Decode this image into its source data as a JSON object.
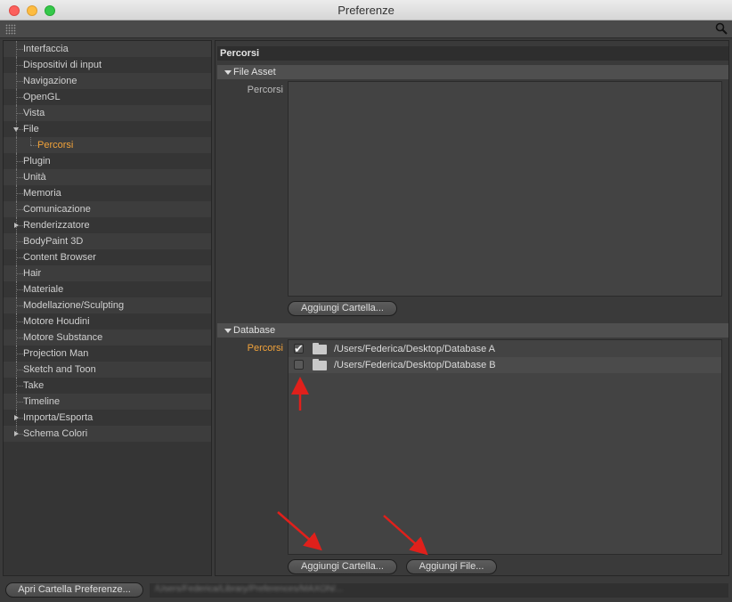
{
  "window": {
    "title": "Preferenze"
  },
  "sidebar": {
    "items": [
      {
        "label": "Interfaccia",
        "level": 0,
        "arrow": "none",
        "active": false
      },
      {
        "label": "Dispositivi di input",
        "level": 0,
        "arrow": "none",
        "active": false
      },
      {
        "label": "Navigazione",
        "level": 0,
        "arrow": "none",
        "active": false
      },
      {
        "label": "OpenGL",
        "level": 0,
        "arrow": "none",
        "active": false
      },
      {
        "label": "Vista",
        "level": 0,
        "arrow": "none",
        "active": false
      },
      {
        "label": "File",
        "level": 0,
        "arrow": "down",
        "active": false
      },
      {
        "label": "Percorsi",
        "level": 1,
        "arrow": "none",
        "active": true
      },
      {
        "label": "Plugin",
        "level": 0,
        "arrow": "none",
        "active": false
      },
      {
        "label": "Unità",
        "level": 0,
        "arrow": "none",
        "active": false
      },
      {
        "label": "Memoria",
        "level": 0,
        "arrow": "none",
        "active": false
      },
      {
        "label": "Comunicazione",
        "level": 0,
        "arrow": "none",
        "active": false
      },
      {
        "label": "Renderizzatore",
        "level": 0,
        "arrow": "right",
        "active": false
      },
      {
        "label": "BodyPaint 3D",
        "level": 0,
        "arrow": "none",
        "active": false
      },
      {
        "label": "Content Browser",
        "level": 0,
        "arrow": "none",
        "active": false
      },
      {
        "label": "Hair",
        "level": 0,
        "arrow": "none",
        "active": false
      },
      {
        "label": "Materiale",
        "level": 0,
        "arrow": "none",
        "active": false
      },
      {
        "label": "Modellazione/Sculpting",
        "level": 0,
        "arrow": "none",
        "active": false
      },
      {
        "label": "Motore Houdini",
        "level": 0,
        "arrow": "none",
        "active": false
      },
      {
        "label": "Motore Substance",
        "level": 0,
        "arrow": "none",
        "active": false
      },
      {
        "label": "Projection Man",
        "level": 0,
        "arrow": "none",
        "active": false
      },
      {
        "label": "Sketch and Toon",
        "level": 0,
        "arrow": "none",
        "active": false
      },
      {
        "label": "Take",
        "level": 0,
        "arrow": "none",
        "active": false
      },
      {
        "label": "Timeline",
        "level": 0,
        "arrow": "none",
        "active": false
      },
      {
        "label": "Importa/Esporta",
        "level": 0,
        "arrow": "right",
        "active": false
      },
      {
        "label": "Schema Colori",
        "level": 0,
        "arrow": "right",
        "active": false
      }
    ]
  },
  "main": {
    "title": "Percorsi",
    "file_asset": {
      "header": "File Asset",
      "field_label": "Percorsi",
      "add_folder_button": "Aggiungi Cartella..."
    },
    "database": {
      "header": "Database",
      "field_label": "Percorsi",
      "paths": [
        {
          "path": "/Users/Federica/Desktop/Database A",
          "checked": true
        },
        {
          "path": "/Users/Federica/Desktop/Database B",
          "checked": false
        }
      ],
      "add_folder_button": "Aggiungi Cartella...",
      "add_file_button": "Aggiungi File..."
    }
  },
  "footer": {
    "open_folder_button": "Apri Cartella Preferenze...",
    "path_blurred": "/Users/Federica/Library/Preferences/MAXON/..."
  },
  "colors": {
    "accent": "#f2a33a",
    "annotation_arrow": "#e0201b"
  },
  "icons": [
    "search-icon",
    "grip-icon",
    "folder-icon",
    "checkmark-icon",
    "triangle-down-icon",
    "triangle-right-icon"
  ]
}
